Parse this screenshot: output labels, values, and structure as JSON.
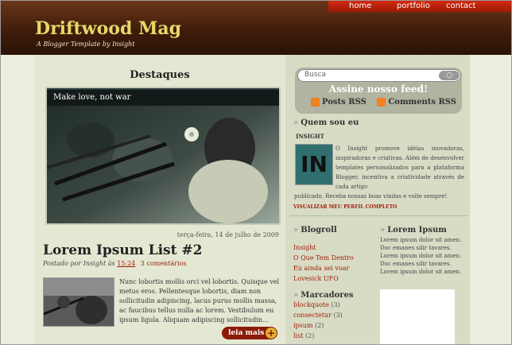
{
  "nav": {
    "home": "home",
    "portfolio": "portfolio",
    "contact": "contact"
  },
  "site": {
    "title": "Driftwood Mag",
    "subtitle": "A Blogger Template by Insight"
  },
  "featured": {
    "heading": "Destaques",
    "caption": "Make love, not war"
  },
  "post": {
    "date": "terça-feira, 14 de julho de 2009",
    "title": "Lorem Ipsum List #2",
    "meta_prefix": "Postado por Insight às",
    "time": "15:24",
    "comments": "3 comentários",
    "excerpt": "Nunc lobortis mollis orci vel lobortis. Quisque vel metus eros. Pellentesque lobortis, diam non sollicitudin adipiscing, lacus purus mollis massa, ac faucibus tellus nulla ac lorem. Vestibulum eu ipsum ligula. Aliquam adipiscing sollicitudin...",
    "more_label": "leia mais"
  },
  "sidebar": {
    "search_placeholder": "Busca",
    "feed_title": "Assine nosso feed!",
    "posts_rss": "Posts RSS",
    "comments_rss": "Comments RSS",
    "about_title": "Quem sou eu",
    "about_name": "INSIGHT",
    "avatar_text": "IN",
    "about_text": "O Insight promove idéias inovadoras, inspiradoras e criativas. Além de desenvolver templates personalizados para a plataforma Blogger, incentiva a criatividade através de cada artigo",
    "about_text2": "publicado. Receba nossas boas vindas e volte sempre!",
    "profile_link": "VISUALIZAR MEU PERFIL COMPLETO",
    "blogroll_title": "Blogroll",
    "blogroll": [
      "Insight",
      "O Que Tem Dentro",
      "Eu ainda sei voar",
      "Lovesick UFO"
    ],
    "lorem_title": "Lorem Ipsum",
    "lorem_text": "Lorem ipsum dolor sit amen. Doc emanes silir tavares. Lorem ipsum dolor sit amen. Doc emanes silir tavares. Lorem ipsum dolor sit amen.",
    "labels_title": "Marcadores",
    "labels": [
      {
        "name": "blockquote",
        "count": "(3)"
      },
      {
        "name": "consectetur",
        "count": "(3)"
      },
      {
        "name": "ipsum",
        "count": "(2)"
      },
      {
        "name": "list",
        "count": "(2)"
      }
    ]
  }
}
